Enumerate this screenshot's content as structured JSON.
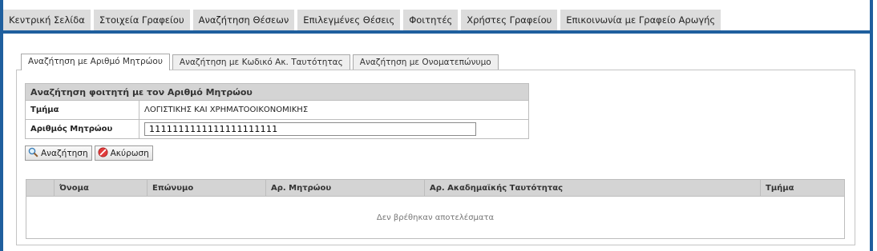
{
  "nav": {
    "items": [
      {
        "label": "Κεντρική Σελίδα"
      },
      {
        "label": "Στοιχεία Γραφείου"
      },
      {
        "label": "Αναζήτηση Θέσεων"
      },
      {
        "label": "Επιλεγμένες Θέσεις"
      },
      {
        "label": "Φοιτητές"
      },
      {
        "label": "Χρήστες Γραφείου"
      },
      {
        "label": "Επικοινωνία με Γραφείο Αρωγής"
      }
    ]
  },
  "tabs": [
    {
      "label": "Αναζήτηση με Αριθμό Μητρώου",
      "active": true
    },
    {
      "label": "Αναζήτηση με Κωδικό Ακ. Ταυτότητας",
      "active": false
    },
    {
      "label": "Αναζήτηση με Ονοματεπώνυμο",
      "active": false
    }
  ],
  "search_form": {
    "title": "Αναζήτηση φοιτητή με τον Αριθμό Μητρώου",
    "department_label": "Τμήμα",
    "department_value": "ΛΟΓΙΣΤΙΚΗΣ ΚΑΙ ΧΡΗΜΑΤΟΟΙΚΟΝΟΜΙΚΗΣ",
    "registry_label": "Αριθμός Μητρώου",
    "registry_value": "1111111111111111111111"
  },
  "buttons": {
    "search_label": "Αναζήτηση",
    "cancel_label": "Ακύρωση"
  },
  "results": {
    "columns": [
      "",
      "Όνομα",
      "Επώνυμο",
      "Αρ. Μητρώου",
      "Αρ. Ακαδημαϊκής Ταυτότητας",
      "Τμήμα"
    ],
    "empty_message": "Δεν βρέθηκαν αποτελέσματα"
  },
  "colors": {
    "frame": "#1f5f9e",
    "nav_bg": "#dcdcdc",
    "header_bg": "#d4d4d4"
  }
}
